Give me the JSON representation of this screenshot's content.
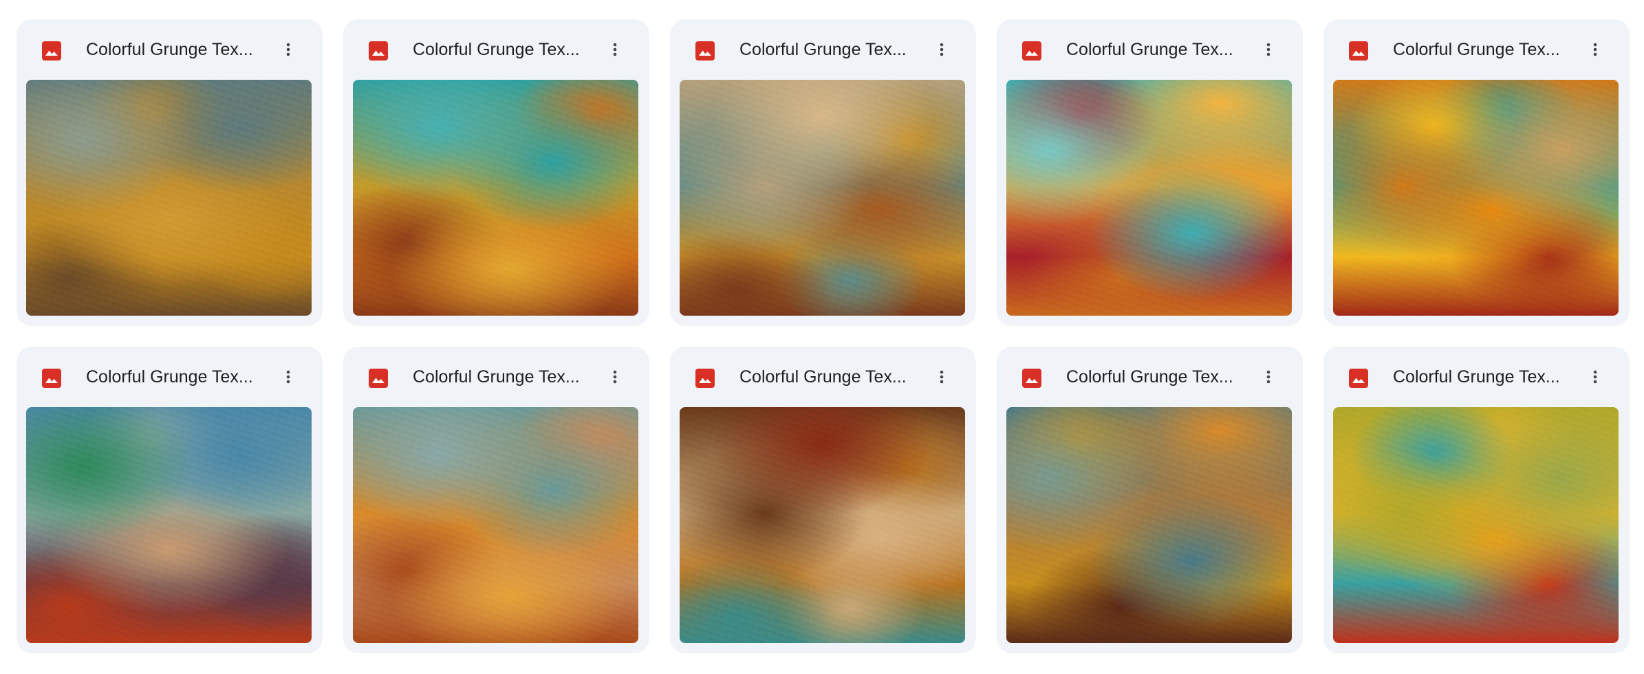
{
  "files": [
    {
      "name": "Colorful Grunge Tex...",
      "file_type": "image",
      "thumbnail": {
        "colors": [
          "#5e7a7c",
          "#b8882e",
          "#c48a1e",
          "#6a4a28",
          "#8d9c8e",
          "#d29a32"
        ]
      }
    },
    {
      "name": "Colorful Grunge Tex...",
      "file_type": "image",
      "thumbnail": {
        "colors": [
          "#2fa0a0",
          "#c49a2a",
          "#d0701a",
          "#8a3a18",
          "#46b0b2",
          "#e2a830"
        ]
      }
    },
    {
      "name": "Colorful Grunge Tex...",
      "file_type": "image",
      "thumbnail": {
        "colors": [
          "#b6a07a",
          "#5e8a86",
          "#c8902a",
          "#7a3a1c",
          "#d8b888",
          "#a65a20"
        ]
      }
    },
    {
      "name": "Colorful Grunge Tex...",
      "file_type": "image",
      "thumbnail": {
        "colors": [
          "#3eaeb2",
          "#e8a030",
          "#a8202a",
          "#c86a1e",
          "#7ac8c4",
          "#f2b440"
        ]
      }
    },
    {
      "name": "Colorful Grunge Tex...",
      "file_type": "image",
      "thumbnail": {
        "colors": [
          "#d07a1a",
          "#3a9a8a",
          "#f0b820",
          "#a02818",
          "#c8a060",
          "#e88a10"
        ]
      }
    },
    {
      "name": "Colorful Grunge Tex...",
      "file_type": "image",
      "thumbnail": {
        "colors": [
          "#4a88a8",
          "#8aa8a0",
          "#5a3a48",
          "#b83a1a",
          "#2e8a5a",
          "#c89a70"
        ]
      }
    },
    {
      "name": "Colorful Grunge Tex...",
      "file_type": "image",
      "thumbnail": {
        "colors": [
          "#6a9a9a",
          "#d88a2a",
          "#c88a5a",
          "#a8481a",
          "#88a8a8",
          "#e6a238"
        ]
      }
    },
    {
      "name": "Colorful Grunge Tex...",
      "file_type": "image",
      "thumbnail": {
        "colors": [
          "#6a3a1a",
          "#c8a878",
          "#b8721e",
          "#3a8a88",
          "#8a2a14",
          "#d8b080"
        ]
      }
    },
    {
      "name": "Colorful Grunge Tex...",
      "file_type": "image",
      "thumbnail": {
        "colors": [
          "#4a7a88",
          "#b07a3a",
          "#c8901e",
          "#5a2a18",
          "#7a9a90",
          "#d88a2a"
        ]
      }
    },
    {
      "name": "Colorful Grunge Tex...",
      "file_type": "image",
      "thumbnail": {
        "colors": [
          "#b0a82a",
          "#e0b42a",
          "#3aa0a0",
          "#c0301a",
          "#9aa84a",
          "#e8a01a"
        ]
      }
    }
  ],
  "icons": {
    "file_type_icon": "image-file-icon",
    "more_icon": "more-vert-icon"
  },
  "colors": {
    "card_background": "#f0f4f9",
    "image_icon": "#d93025",
    "text": "#1f1f1f",
    "more_icon": "#444746"
  }
}
